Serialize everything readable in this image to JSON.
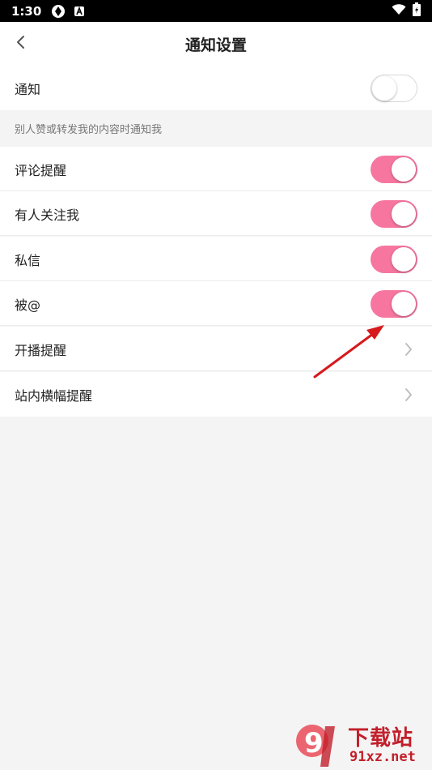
{
  "status_bar": {
    "time": "1:30"
  },
  "header": {
    "title": "通知设置"
  },
  "notify_row": {
    "label": "通知",
    "toggle_on": false
  },
  "section_note": "别人赞或转发我的内容时通知我",
  "toggle_rows": [
    {
      "label": "评论提醒",
      "toggle_on": true
    },
    {
      "label": "有人关注我",
      "toggle_on": true
    },
    {
      "label": "私信",
      "toggle_on": true
    },
    {
      "label": "被@",
      "toggle_on": true
    }
  ],
  "link_rows": [
    {
      "label": "开播提醒"
    },
    {
      "label": "站内横幅提醒"
    }
  ],
  "colors": {
    "accent": "#f6769f",
    "annotation": "#d7191c",
    "watermark": "#c21f2a"
  },
  "watermark": {
    "brand": "下载站",
    "url": "91xz.net",
    "logo_text": "9"
  }
}
